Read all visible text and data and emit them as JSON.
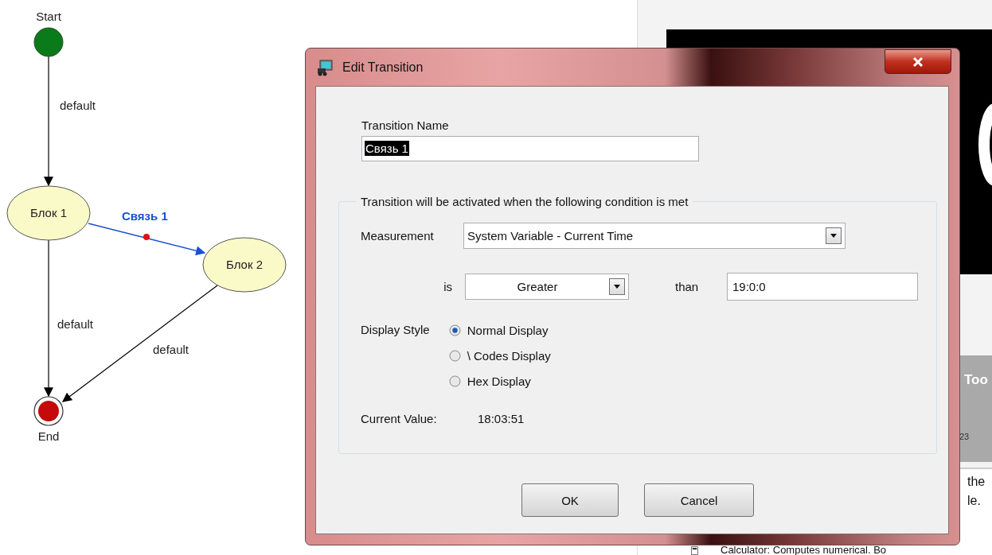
{
  "diagram": {
    "nodes": [
      {
        "kind": "start",
        "label": "Start"
      },
      {
        "kind": "state",
        "label": "Блок 1"
      },
      {
        "kind": "state",
        "label": "Блок 2"
      },
      {
        "kind": "end",
        "label": "End"
      }
    ],
    "edges": [
      {
        "label": "default",
        "selected": false
      },
      {
        "label": "Связь 1",
        "selected": true
      },
      {
        "label": "default",
        "selected": false
      },
      {
        "label": "default",
        "selected": false
      }
    ]
  },
  "background_window": {
    "toolbar_title": "Too",
    "toolbar_number": "23",
    "text_lines": [
      "the",
      "le."
    ],
    "list_item": "Calculator: Computes numerical. Bo"
  },
  "dialog": {
    "title": "Edit Transition",
    "name_label": "Transition Name",
    "name_value": "Связь 1",
    "name_text_selected": true,
    "group_title": "Transition will be activated when the following condition is met",
    "measurement": {
      "label": "Measurement",
      "value": "System Variable - Current Time"
    },
    "operator": {
      "label": "is",
      "value": "Greater"
    },
    "threshold": {
      "label": "than",
      "value": "19:0:0"
    },
    "display_style": {
      "label": "Display Style",
      "options": [
        {
          "label": "Normal Display",
          "selected": true
        },
        {
          "label": "\\ Codes Display",
          "selected": false
        },
        {
          "label": "Hex Display",
          "selected": false
        }
      ]
    },
    "current_value": {
      "label": "Current Value:",
      "value": "18:03:51"
    },
    "buttons": [
      "OK",
      "Cancel"
    ]
  }
}
